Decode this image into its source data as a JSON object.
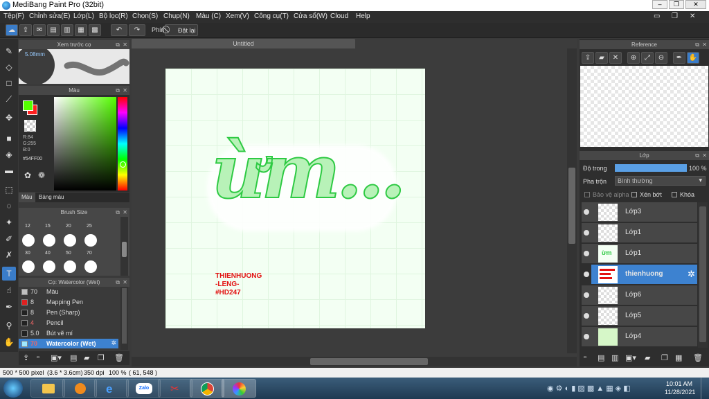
{
  "app_title": "MediBang Paint Pro (32bit)",
  "menu": [
    "Tệp(F)",
    "Chỉnh sửa(E)",
    "Lớp(L)",
    "Bộ lọc(R)",
    "Chọn(S)",
    "Chụp(N)",
    "Màu (C)",
    "Xem(V)",
    "Công cụ(T)",
    "Cửa sổ(W)",
    "Cloud",
    "Help"
  ],
  "toolbar": {
    "shortcut_label": "Phím",
    "reset_label": "Đặt lại"
  },
  "brush_preview": {
    "title": "Xem trước cọ",
    "size": "5.08mm"
  },
  "color_panel": {
    "title": "Màu",
    "r": "R:84",
    "g": "G:255",
    "b": "B:0",
    "hex": "#54FF00",
    "fg_color": "#54ff00",
    "bg_color": "#ff2020",
    "tab_color": "Màu",
    "tab_palette": "Bảng màu"
  },
  "brush_size": {
    "title": "Brush Size",
    "row1": [
      "12",
      "15",
      "20",
      "25"
    ],
    "row2": [
      "30",
      "40",
      "50",
      "70"
    ]
  },
  "brush_list": {
    "title": "Cọ: Watercolor (Wet)",
    "items": [
      {
        "size": "70",
        "name": "Màu",
        "color": "#c0c0c0"
      },
      {
        "size": "8",
        "name": "Mapping Pen",
        "color": "#e02020"
      },
      {
        "size": "8",
        "name": "Pen (Sharp)",
        "color": "#222222"
      },
      {
        "size": "4",
        "name": "Pencil",
        "color": "#222222"
      },
      {
        "size": "5.0",
        "name": "Bút vẽ mí",
        "color": "#222222"
      },
      {
        "size": "70",
        "name": "Watercolor (Wet)",
        "color": "#9fe8ff"
      }
    ]
  },
  "document": {
    "tab_title": "Untitled",
    "art_text": "ừm...",
    "signature": [
      "THIENHUONG",
      "-LENG-",
      "#HD247"
    ]
  },
  "reference": {
    "title": "Reference"
  },
  "layers": {
    "title": "Lớp",
    "opacity_label": "Độ trong",
    "opacity_value": "100 %",
    "opacity": 1.0,
    "blend_label": "Pha trộn",
    "blend_value": "Bình thường",
    "protect_alpha": "Bảo vệ alpha",
    "clipping": "Xén bớt",
    "lock": "Khóa",
    "items": [
      {
        "name": "Lớp3"
      },
      {
        "name": "Lớp1"
      },
      {
        "name": "Lớp1"
      },
      {
        "name": "thienhuong",
        "selected": true
      },
      {
        "name": "Lớp6"
      },
      {
        "name": "Lớp5"
      },
      {
        "name": "Lớp4"
      }
    ]
  },
  "status": {
    "size": "500 * 500 pixel",
    "dims": "(3.6 * 3.6cm)",
    "dpi": "350 dpi",
    "zoom": "100 %",
    "coords": "( 61, 548 )"
  },
  "taskbar": {
    "time": "10:01 AM",
    "date": "11/28/2021",
    "zalo": "Zalo"
  },
  "colors": {
    "accent": "#3d82d0",
    "fg": "#54ff00"
  }
}
